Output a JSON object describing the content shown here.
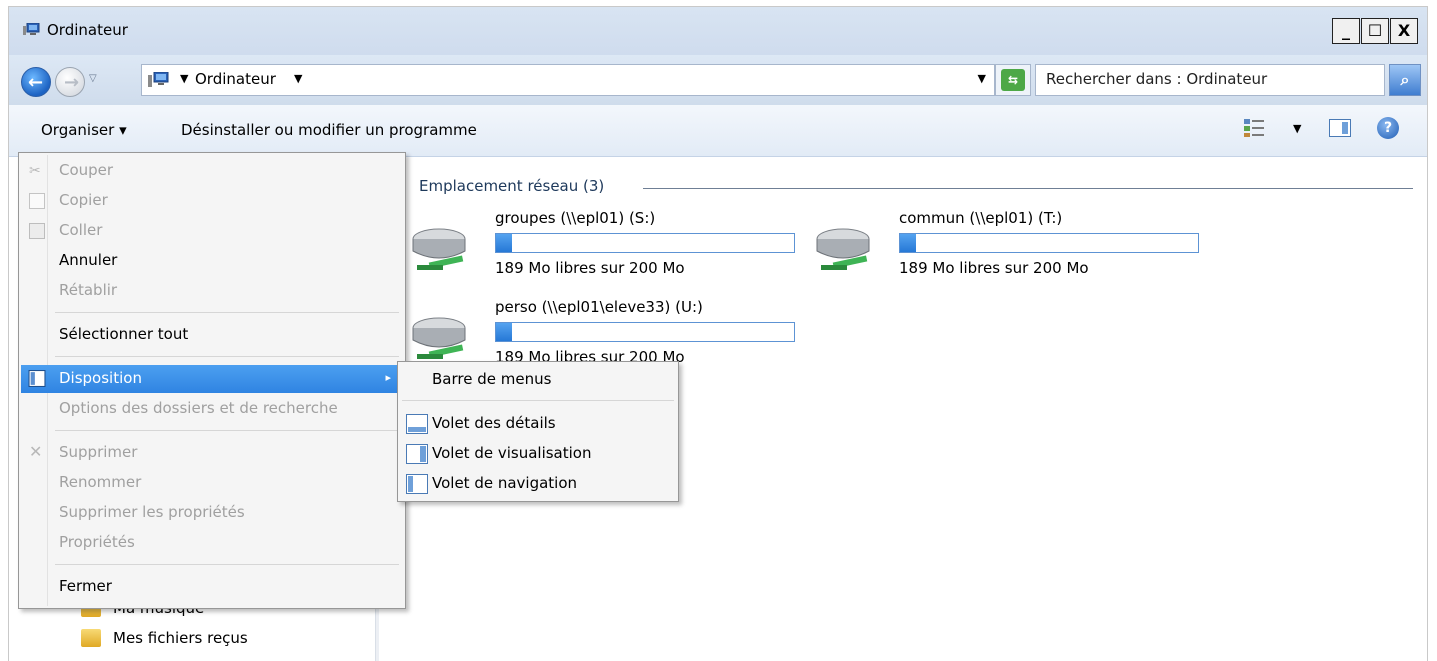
{
  "window": {
    "title": "Ordinateur",
    "minimize_label": "_",
    "maximize_label": "☐",
    "close_label": "X"
  },
  "address": {
    "location": "Ordinateur",
    "search_placeholder": "Rechercher dans : Ordinateur"
  },
  "toolbar": {
    "organize_label": "Organiser ▾",
    "uninstall_label": "Désinstaller ou modifier un programme",
    "help_label": "?"
  },
  "content": {
    "group_title": "Emplacement réseau (3)",
    "drives": [
      {
        "name": "groupes (\\\\epl01) (S:)",
        "free_text": "189 Mo libres sur 200 Mo",
        "used_fraction": 0.055
      },
      {
        "name": "commun (\\\\epl01) (T:)",
        "free_text": "189 Mo libres sur 200 Mo",
        "used_fraction": 0.055
      },
      {
        "name": "perso (\\\\epl01\\eleve33) (U:)",
        "free_text": "189 Mo libres sur 200 Mo",
        "used_fraction": 0.055
      }
    ]
  },
  "navpane": {
    "items": [
      {
        "label": "Ma musique"
      },
      {
        "label": "Mes fichiers reçus"
      }
    ]
  },
  "menu": {
    "items": [
      {
        "label": "Couper",
        "icon": "scissors-icon",
        "enabled": false
      },
      {
        "label": "Copier",
        "icon": "copy-icon",
        "enabled": false
      },
      {
        "label": "Coller",
        "icon": "paste-icon",
        "enabled": false
      },
      {
        "label": "Annuler",
        "icon": "",
        "enabled": true
      },
      {
        "label": "Rétablir",
        "icon": "",
        "enabled": false
      },
      {
        "label": "Sélectionner tout",
        "icon": "",
        "enabled": true
      },
      {
        "label": "Disposition",
        "icon": "layout-icon",
        "enabled": true,
        "highlighted": true,
        "submenu_arrow": "▸"
      },
      {
        "label": "Options des dossiers et de recherche",
        "icon": "",
        "enabled": false
      },
      {
        "label": "Supprimer",
        "icon": "delete-icon",
        "enabled": false
      },
      {
        "label": "Renommer",
        "icon": "",
        "enabled": false
      },
      {
        "label": "Supprimer les propriétés",
        "icon": "",
        "enabled": false
      },
      {
        "label": "Propriétés",
        "icon": "",
        "enabled": false
      },
      {
        "label": "Fermer",
        "icon": "",
        "enabled": true
      }
    ]
  },
  "submenu": {
    "items": [
      {
        "label": "Barre de menus",
        "icon": ""
      },
      {
        "label": "Volet des détails",
        "icon": "details-pane-icon"
      },
      {
        "label": "Volet de visualisation",
        "icon": "preview-pane-icon"
      },
      {
        "label": "Volet de navigation",
        "icon": "navigation-pane-icon"
      }
    ]
  },
  "colors": {
    "highlight": "#3a8ee6",
    "disabled_text": "#a0a0a0",
    "progress_fill": "#2f84e2"
  }
}
